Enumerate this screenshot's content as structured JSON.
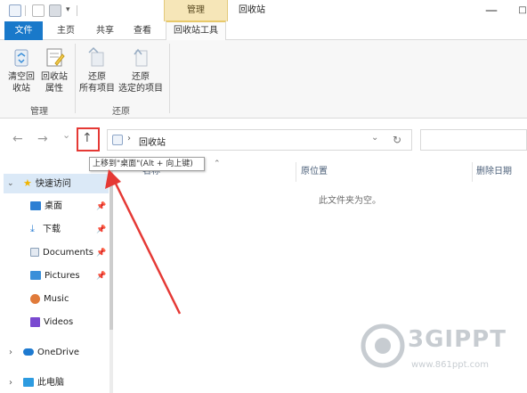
{
  "window": {
    "context_tab": "管理",
    "title": "回收站",
    "minimize_glyph": "—",
    "maximize_glyph": "□"
  },
  "tabs": {
    "file": "文件",
    "home": "主页",
    "share": "共享",
    "view": "查看",
    "recycle_tools": "回收站工具"
  },
  "ribbon": {
    "groups": [
      {
        "label": "管理",
        "buttons": [
          {
            "line1": "清空回",
            "line2": "收站",
            "icon": "empty-recycle-bin-icon"
          },
          {
            "line1": "回收站",
            "line2": "属性",
            "icon": "recycle-bin-properties-icon"
          }
        ]
      },
      {
        "label": "还原",
        "buttons": [
          {
            "line1": "还原",
            "line2": "所有项目",
            "icon": "restore-all-icon"
          },
          {
            "line1": "还原",
            "line2": "选定的项目",
            "icon": "restore-selected-icon"
          }
        ]
      }
    ]
  },
  "nav": {
    "back": "←",
    "forward": "→",
    "recent": "⌄",
    "up": "↑",
    "breadcrumb_sep": "›",
    "address": "回收站",
    "dropdown": "⌄",
    "refresh": "↻",
    "search_placeholder": ""
  },
  "tooltip": "上移到\"桌面\"(Alt + 向上键)",
  "sidebar": {
    "quick_access": "快速访问",
    "items": [
      {
        "label": "桌面",
        "pinned": true,
        "icon": "desktop-icon",
        "color": "#2d7fd3"
      },
      {
        "label": "下载",
        "pinned": true,
        "icon": "download-icon",
        "color": "#2d7fd3"
      },
      {
        "label": "Documents",
        "pinned": true,
        "icon": "documents-icon",
        "color": "#8aa0b8"
      },
      {
        "label": "Pictures",
        "pinned": true,
        "icon": "pictures-icon",
        "color": "#3a8fd9"
      },
      {
        "label": "Music",
        "pinned": false,
        "icon": "music-icon",
        "color": "#e07a3a"
      },
      {
        "label": "Videos",
        "pinned": false,
        "icon": "videos-icon",
        "color": "#7a4ad0"
      }
    ],
    "onedrive": "OneDrive",
    "this_pc": "此电脑",
    "expand_glyph": "›",
    "collapse_glyph": "⌄",
    "pin_glyph": "📌"
  },
  "columns": {
    "name": "名称",
    "original_location": "原位置",
    "date_deleted": "删除日期",
    "sort_glyph": "⌃"
  },
  "content": {
    "empty_message": "此文件夹为空。"
  },
  "watermark": {
    "brand": "3GIPPT",
    "url": "www.861ppt.com"
  },
  "colors": {
    "file_tab": "#1979ca",
    "context_tab": "#f6e6b8",
    "highlight_box": "#e53935",
    "annotation_arrow": "#e53935",
    "quick_access_bg": "#dbe9f7"
  }
}
